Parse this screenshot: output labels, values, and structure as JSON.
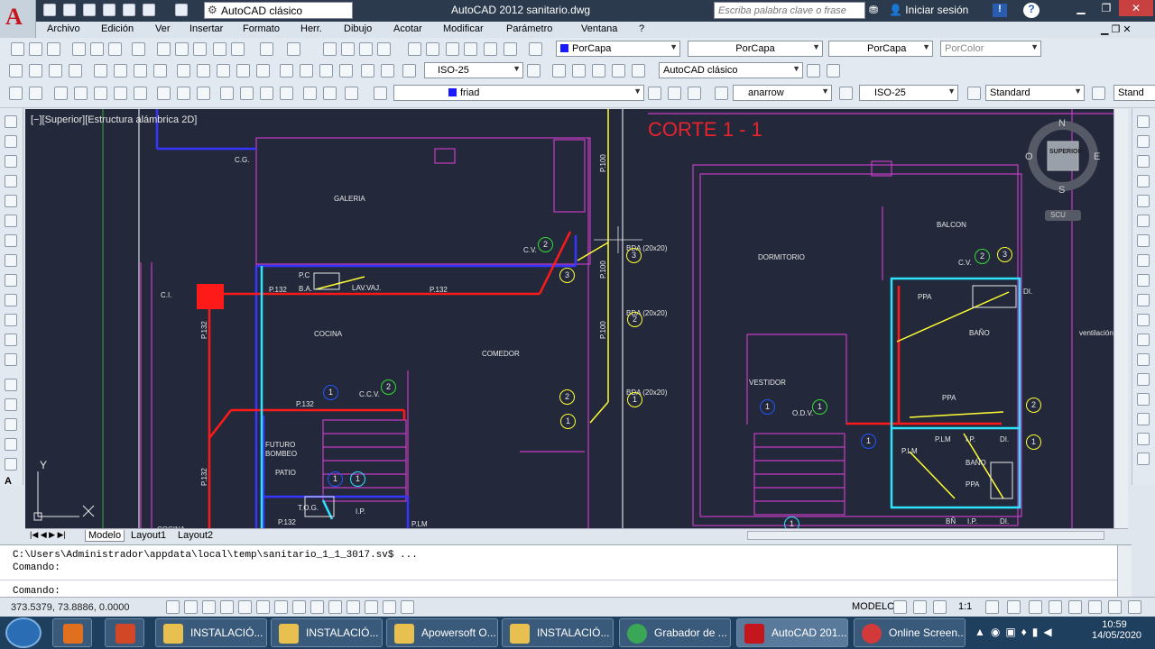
{
  "title_bar": {
    "workspace": "AutoCAD clásico",
    "app_title": "AutoCAD 2012   sanitario.dwg",
    "search_placeholder": "Escriba palabra clave o frase",
    "login": "Iniciar sesión"
  },
  "menu": [
    "Archivo",
    "Edición",
    "Ver",
    "Insertar",
    "Formato",
    "Herr.",
    "Dibujo",
    "Acotar",
    "Modificar",
    "Parámetro",
    "Ventana",
    "?"
  ],
  "properties_toolbar": {
    "color": "PorCapa",
    "linetype": "PorCapa",
    "lineweight": "PorCapa",
    "plotstyle": "PorColor"
  },
  "dims_toolbar": {
    "dimstyle": "ISO-25",
    "workspace": "AutoCAD clásico"
  },
  "layers_toolbar": {
    "layer": "friad",
    "arrow": "anarrow",
    "dimstyle": "ISO-25",
    "textstyle": "Standard",
    "tablestyle": "Stand"
  },
  "viewport": {
    "label": "[−][Superior][Estructura alámbrica 2D]",
    "heading": "CORTE 1 - 1",
    "viewcube_top": "SUPERIOR",
    "viewcube_n": "N",
    "viewcube_s": "S",
    "viewcube_e": "E",
    "viewcube_o": "O",
    "ucs_label": "SCU",
    "ucs_y": "Y",
    "labels": [
      {
        "t": "C.G."
      },
      {
        "t": "GALERIA"
      },
      {
        "t": "C.V."
      },
      {
        "t": "BDA (20x20)"
      },
      {
        "t": "C.I."
      },
      {
        "t": "P.132"
      },
      {
        "t": "P.C"
      },
      {
        "t": "B.A."
      },
      {
        "t": "LAV.VAJ."
      },
      {
        "t": "P.132"
      },
      {
        "t": "COCINA"
      },
      {
        "t": "COMEDOR"
      },
      {
        "t": "P.132"
      },
      {
        "t": "C.C.V."
      },
      {
        "t": "BDA (20x20)"
      },
      {
        "t": "BDA (20x20)"
      },
      {
        "t": "FUTURO"
      },
      {
        "t": "BOMBEO"
      },
      {
        "t": "PATIO"
      },
      {
        "t": "T.O.G."
      },
      {
        "t": "I.P."
      },
      {
        "t": "P.LM"
      },
      {
        "t": "P.132"
      },
      {
        "t": "DORMITORIO"
      },
      {
        "t": "BALCON"
      },
      {
        "t": "C.V."
      },
      {
        "t": "PPA"
      },
      {
        "t": "BAÑO"
      },
      {
        "t": "VESTIDOR"
      },
      {
        "t": "O.D.V."
      },
      {
        "t": "PPA"
      },
      {
        "t": "P.LM"
      },
      {
        "t": "P.LM"
      },
      {
        "t": "I.P."
      },
      {
        "t": "DI."
      },
      {
        "t": "BAÑO"
      },
      {
        "t": "PPA"
      },
      {
        "t": "DI."
      },
      {
        "t": "ventilación cocina"
      },
      {
        "t": "P.132"
      },
      {
        "t": "P.132"
      },
      {
        "t": "P.100"
      },
      {
        "t": "P.100"
      },
      {
        "t": "P.100"
      },
      {
        "t": "COCINA"
      },
      {
        "t": "BÑ"
      },
      {
        "t": "I.P."
      },
      {
        "t": "DI."
      }
    ],
    "circles": [
      {
        "n": "2"
      },
      {
        "n": "3"
      },
      {
        "n": "3"
      },
      {
        "n": "2"
      },
      {
        "n": "1"
      },
      {
        "n": "2"
      },
      {
        "n": "1"
      },
      {
        "n": "1"
      },
      {
        "n": "1"
      },
      {
        "n": "1"
      },
      {
        "n": "2"
      },
      {
        "n": "1"
      },
      {
        "n": "3"
      },
      {
        "n": "2"
      },
      {
        "n": "1"
      },
      {
        "n": "1"
      },
      {
        "n": "2"
      },
      {
        "n": "1"
      },
      {
        "n": "1"
      }
    ]
  },
  "layout_tabs": [
    "Modelo",
    "Layout1",
    "Layout2"
  ],
  "command": {
    "line1": "C:\\Users\\Administrador\\appdata\\local\\temp\\sanitario_1_1_3017.sv$ ...",
    "line2": "Comando:",
    "prompt": "Comando:"
  },
  "status": {
    "coords": "373.5379, 73.8886, 0.0000",
    "model": "MODELO",
    "scale": "1:1"
  },
  "taskbar": {
    "items": [
      "INSTALACIÓ...",
      "INSTALACIÓ...",
      "Apowersoft O...",
      "INSTALACIÓ...",
      "Grabador de ...",
      "AutoCAD 201...",
      "Online Screen..."
    ],
    "time": "10:59",
    "date": "14/05/2020"
  },
  "colors": {
    "bg": "#23293a",
    "wall": "#c43cc4",
    "pipe_red": "#ff1a1a",
    "pipe_blue": "#3535ff",
    "cyan": "#2fe3ff",
    "yellow": "#ffff33",
    "green": "#33dd33"
  }
}
